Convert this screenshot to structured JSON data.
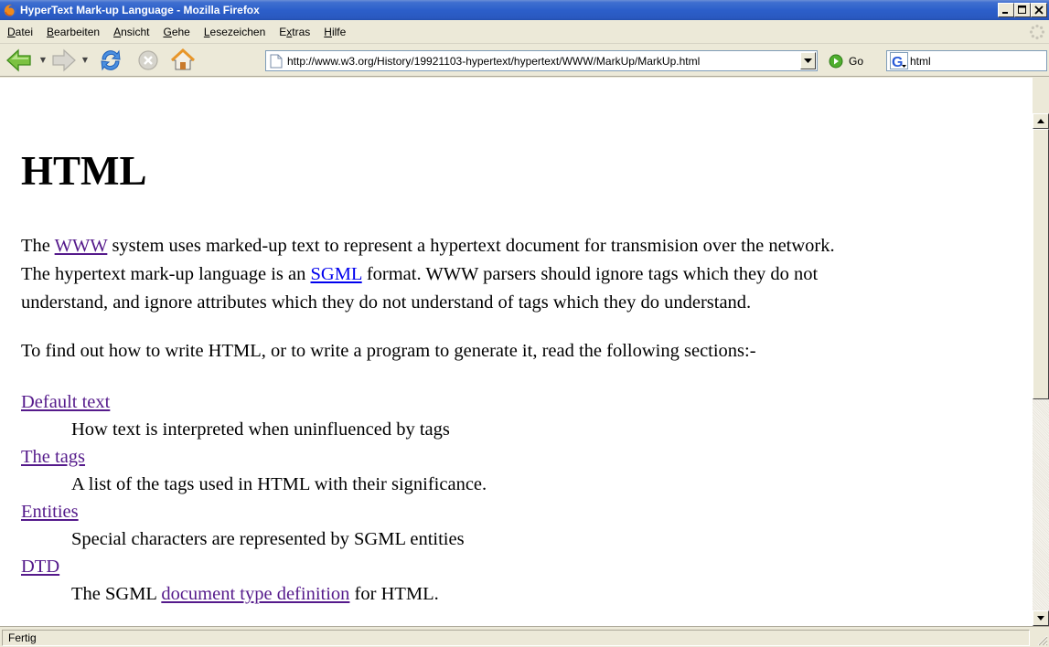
{
  "window": {
    "title": "HyperText Mark-up Language - Mozilla Firefox",
    "accent": "#2c5fca"
  },
  "menu": {
    "items": [
      {
        "pre": "",
        "key": "D",
        "post": "atei"
      },
      {
        "pre": "",
        "key": "B",
        "post": "earbeiten"
      },
      {
        "pre": "",
        "key": "A",
        "post": "nsicht"
      },
      {
        "pre": "",
        "key": "G",
        "post": "ehe"
      },
      {
        "pre": "",
        "key": "L",
        "post": "esezeichen"
      },
      {
        "pre": "E",
        "key": "x",
        "post": "tras"
      },
      {
        "pre": "",
        "key": "H",
        "post": "ilfe"
      }
    ]
  },
  "toolbar": {
    "back_icon": "back-arrow-icon",
    "forward_icon": "forward-arrow-icon",
    "reload_icon": "reload-icon",
    "stop_icon": "stop-icon",
    "home_icon": "home-icon",
    "url": "http://www.w3.org/History/19921103-hypertext/hypertext/WWW/MarkUp/MarkUp.html",
    "go_label": "Go",
    "search_value": "html"
  },
  "page": {
    "heading": "HTML",
    "p1": {
      "l1_a": "The ",
      "l1_link": "WWW",
      "l1_b": " system uses marked-up text to represent a hypertext document for transmision over the network.",
      "l2_a": "The hypertext mark-up language is an ",
      "l2_link": "SGML",
      "l2_b": " format. WWW parsers should ignore tags which they do not",
      "l3": "understand, and ignore attributes which they do not understand of tags which they do understand."
    },
    "p2": "To find out how to write HTML, or to write a program to generate it, read the following sections:-",
    "sections": [
      {
        "term": "Default text",
        "desc": "How text is interpreted when uninfluenced by tags"
      },
      {
        "term": "The tags",
        "desc": "A list of the tags used in HTML with their significance."
      },
      {
        "term": "Entities",
        "desc": "Special characters are represented by SGML entities"
      },
      {
        "term": "DTD",
        "desc_a": "The SGML ",
        "desc_link": "document type definition",
        "desc_b": " for HTML."
      }
    ],
    "visited_link_color": "#551a8b",
    "link_color": "#0000ee"
  },
  "status": {
    "text": "Fertig"
  }
}
